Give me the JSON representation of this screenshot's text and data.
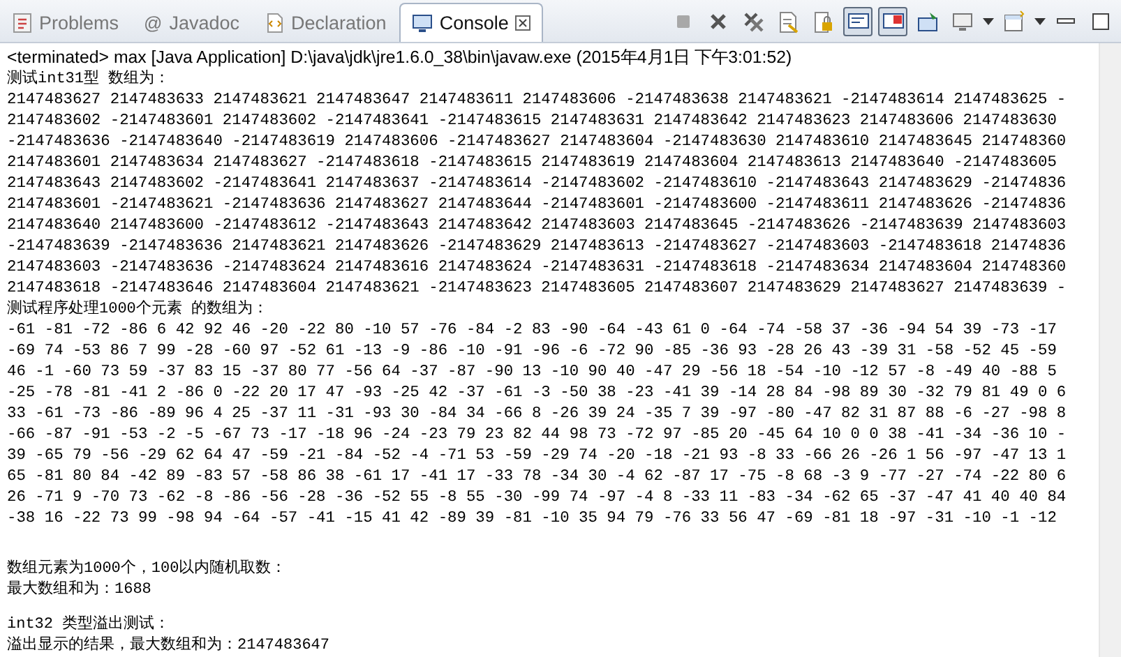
{
  "tabs": [
    {
      "label": "Problems",
      "kind": "problems",
      "selected": false
    },
    {
      "label": "Javadoc",
      "kind": "javadoc",
      "glyph": "@",
      "selected": false
    },
    {
      "label": "Declaration",
      "kind": "declaration",
      "selected": false
    },
    {
      "label": "Console",
      "kind": "console",
      "selected": true,
      "closable": true
    }
  ],
  "toolbar": [
    {
      "kind": "terminate",
      "pressed": false
    },
    {
      "kind": "remove",
      "pressed": false
    },
    {
      "kind": "remove-all",
      "pressed": false
    },
    {
      "kind": "clear",
      "pressed": false
    },
    {
      "kind": "scroll-lock",
      "pressed": false
    },
    {
      "kind": "show-out",
      "pressed": true
    },
    {
      "kind": "show-err",
      "pressed": true
    },
    {
      "kind": "pin",
      "pressed": false
    },
    {
      "kind": "display",
      "pressed": false,
      "menu": true
    },
    {
      "kind": "open",
      "pressed": false,
      "menu": true
    },
    {
      "kind": "minimize",
      "pressed": false
    },
    {
      "kind": "maximize",
      "pressed": false
    }
  ],
  "console": {
    "header": "<terminated> max [Java Application] D:\\java\\jdk\\jre1.6.0_38\\bin\\javaw.exe (2015年4月1日 下午3:01:52)",
    "lines": [
      {
        "kind": "label",
        "text": "测试int31型 数组为："
      },
      {
        "kind": "output",
        "text": "2147483627 2147483633 2147483621 2147483647 2147483611 2147483606 -2147483638 2147483621 -2147483614 2147483625 -"
      },
      {
        "kind": "output",
        "text": "2147483602 -2147483601 2147483602 -2147483641 -2147483615 2147483631 2147483642 2147483623 2147483606 2147483630"
      },
      {
        "kind": "output",
        "text": "-2147483636 -2147483640 -2147483619 2147483606 -2147483627 2147483604 -2147483630 2147483610 2147483645 214748360"
      },
      {
        "kind": "output",
        "text": "2147483601 2147483634 2147483627 -2147483618 -2147483615 2147483619 2147483604 2147483613 2147483640 -2147483605"
      },
      {
        "kind": "output",
        "text": "2147483643 2147483602 -2147483641 2147483637 -2147483614 -2147483602 -2147483610 -2147483643 2147483629 -21474836"
      },
      {
        "kind": "output",
        "text": "2147483601 -2147483621 -2147483636 2147483627 2147483644 -2147483601 -2147483600 -2147483611 2147483626 -21474836"
      },
      {
        "kind": "output",
        "text": "2147483640 2147483600 -2147483612 -2147483643 2147483642 2147483603 2147483645 -2147483626 -2147483639 2147483603"
      },
      {
        "kind": "output",
        "text": "-2147483639 -2147483636 2147483621 2147483626 -2147483629 2147483613 -2147483627 -2147483603 -2147483618 21474836"
      },
      {
        "kind": "output",
        "text": "2147483603 -2147483636 -2147483624 2147483616 2147483624 -2147483631 -2147483618 -2147483634 2147483604 214748360"
      },
      {
        "kind": "output",
        "text": "2147483618 -2147483646 2147483604 2147483621 -2147483623 2147483605 2147483607 2147483629 2147483627 2147483639 -"
      },
      {
        "kind": "label",
        "text": "测试程序处理1000个元素 的数组为："
      },
      {
        "kind": "output",
        "text": "-61 -81 -72 -86 6 42 92 46 -20 -22 80 -10 57 -76 -84 -2 83 -90 -64 -43 61 0 -64 -74 -58 37 -36 -94 54 39 -73 -17"
      },
      {
        "kind": "output",
        "text": "-69 74 -53 86 7 99 -28 -60 97 -52 61 -13 -9 -86 -10 -91 -96 -6 -72 90 -85 -36 93 -28 26 43 -39 31 -58 -52 45 -59"
      },
      {
        "kind": "output",
        "text": "46 -1 -60 73 59 -37 83 15 -37 80 77 -56 64 -37 -87 -90 13 -10 90 40 -47 29 -56 18 -54 -10 -12 57 -8 -49 40 -88 5"
      },
      {
        "kind": "output",
        "text": "-25 -78 -81 -41 2 -86 0 -22 20 17 47 -93 -25 42 -37 -61 -3 -50 38 -23 -41 39 -14 28 84 -98 89 30 -32 79 81 49 0 6"
      },
      {
        "kind": "output",
        "text": "33 -61 -73 -86 -89 96 4 25 -37 11 -31 -93 30 -84 34 -66 8 -26 39 24 -35 7 39 -97 -80 -47 82 31 87 88 -6 -27 -98 8"
      },
      {
        "kind": "output",
        "text": "-66 -87 -91 -53 -2 -5 -67 73 -17 -18 96 -24 -23 79 23 82 44 98 73 -72 97 -85 20 -45 64 10 0 0 38 -41 -34 -36 10 -"
      },
      {
        "kind": "output",
        "text": "39 -65 79 -56 -29 62 64 47 -59 -21 -84 -52 -4 -71 53 -59 -29 74 -20 -18 -21 93 -8 33 -66 26 -26 1 56 -97 -47 13 1"
      },
      {
        "kind": "output",
        "text": "65 -81 80 84 -42 89 -83 57 -58 86 38 -61 17 -41 17 -33 78 -34 30 -4 62 -87 17 -75 -8 68 -3 9 -77 -27 -74 -22 80 6"
      },
      {
        "kind": "output",
        "text": "26 -71 9 -70 73 -62 -8 -86 -56 -28 -36 -52 55 -8 55 -30 -99 74 -97 -4 8 -33 11 -83 -34 -62 65 -37 -47 41 40 40 84"
      },
      {
        "kind": "output",
        "text": "-38 16 -22 73 99 -98 94 -64 -57 -41 -15 41 42 -89 39 -81 -10 35 94 79 -76 33 56 47 -69 -81 18 -97 -31 -10 -1 -12"
      },
      {
        "kind": "gap"
      },
      {
        "kind": "gap"
      },
      {
        "kind": "label",
        "text": "数组元素为1000个，100以内随机取数："
      },
      {
        "kind": "label",
        "text": "最大数组和为：1688"
      },
      {
        "kind": "gap"
      },
      {
        "kind": "label",
        "text": "int32 类型溢出测试："
      },
      {
        "kind": "label",
        "text": "溢出显示的结果，最大数组和为：2147483647"
      }
    ]
  }
}
